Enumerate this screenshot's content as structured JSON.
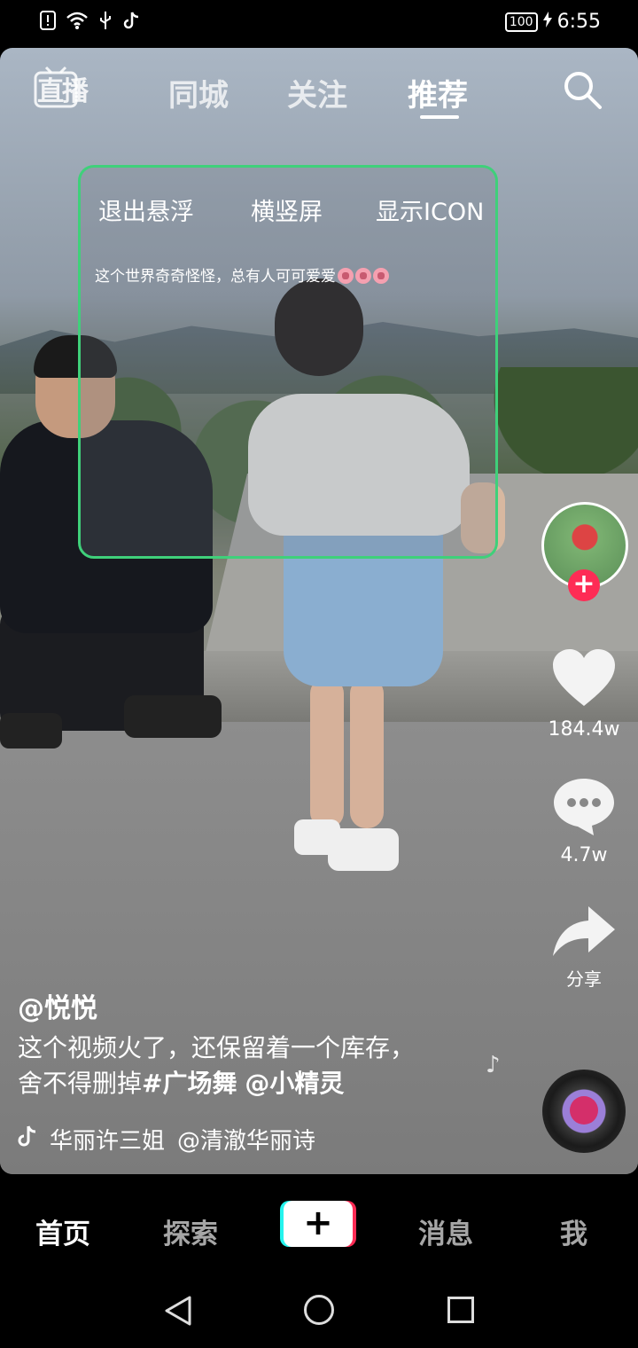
{
  "status_bar": {
    "battery": "100",
    "time": "6:55"
  },
  "top_nav": {
    "live_label": "直播",
    "tabs": [
      {
        "label": "同城"
      },
      {
        "label": "关注"
      },
      {
        "label": "推荐"
      }
    ]
  },
  "float_panel": {
    "exit_label": "退出悬浮",
    "orientation_label": "横竖屏",
    "show_icon_label": "显示ICON",
    "caption": "这个世界奇奇怪怪，总有人可可爱爱"
  },
  "sidebar": {
    "like_count": "184.4w",
    "comment_count": "4.7w",
    "share_label": "分享"
  },
  "video_info": {
    "author": "@悦悦",
    "desc_line1": "这个视频火了，还保留着一个库存，",
    "desc_line2_plain": "舍不得删掉",
    "desc_tag": "#广场舞",
    "desc_mention": "@小精灵",
    "music_title": "华丽许三姐",
    "music_author": "@清澈华丽诗"
  },
  "bottom_nav": {
    "items": [
      {
        "label": "首页"
      },
      {
        "label": "探索"
      },
      {
        "label": "+"
      },
      {
        "label": "消息"
      },
      {
        "label": "我"
      }
    ]
  }
}
